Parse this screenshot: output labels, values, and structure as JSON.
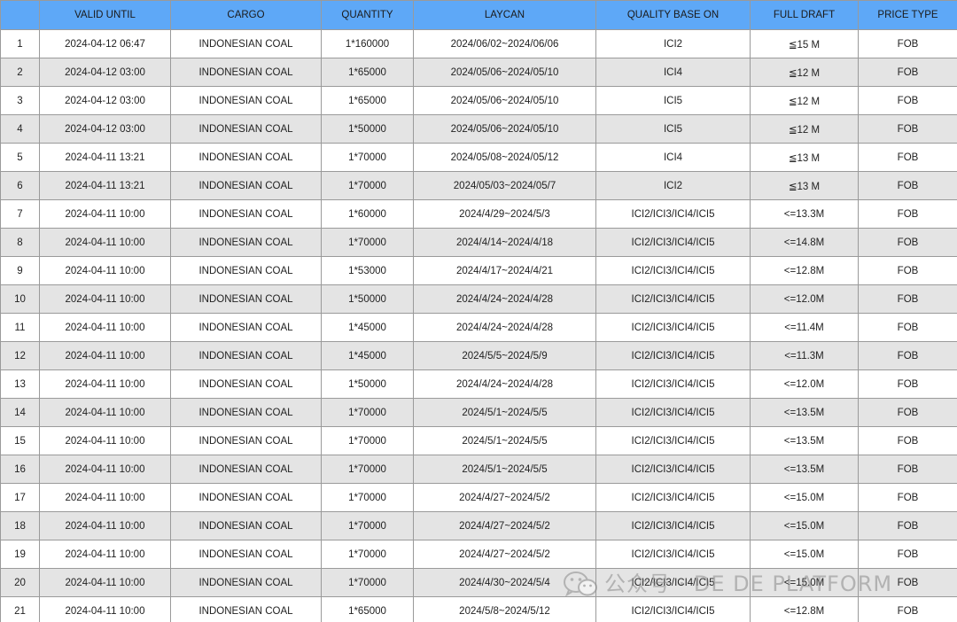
{
  "table": {
    "columns": [
      "",
      "VALID UNTIL",
      "CARGO",
      "QUANTITY",
      "LAYCAN",
      "QUALITY BASE ON",
      "FULL DRAFT",
      "PRICE TYPE"
    ],
    "rows": [
      [
        "1",
        "2024-04-12 06:47",
        "INDONESIAN COAL",
        "1*160000",
        "2024/06/02~2024/06/06",
        "ICI2",
        "≦15 M",
        "FOB"
      ],
      [
        "2",
        "2024-04-12 03:00",
        "INDONESIAN COAL",
        "1*65000",
        "2024/05/06~2024/05/10",
        "ICI4",
        "≦12 M",
        "FOB"
      ],
      [
        "3",
        "2024-04-12 03:00",
        "INDONESIAN COAL",
        "1*65000",
        "2024/05/06~2024/05/10",
        "ICI5",
        "≦12 M",
        "FOB"
      ],
      [
        "4",
        "2024-04-12 03:00",
        "INDONESIAN COAL",
        "1*50000",
        "2024/05/06~2024/05/10",
        "ICI5",
        "≦12 M",
        "FOB"
      ],
      [
        "5",
        "2024-04-11 13:21",
        "INDONESIAN COAL",
        "1*70000",
        "2024/05/08~2024/05/12",
        "ICI4",
        "≦13 M",
        "FOB"
      ],
      [
        "6",
        "2024-04-11 13:21",
        "INDONESIAN COAL",
        "1*70000",
        "2024/05/03~2024/05/7",
        "ICI2",
        "≦13 M",
        "FOB"
      ],
      [
        "7",
        "2024-04-11 10:00",
        "INDONESIAN COAL",
        "1*60000",
        "2024/4/29~2024/5/3",
        "ICI2/ICI3/ICI4/ICI5",
        "<=13.3M",
        "FOB"
      ],
      [
        "8",
        "2024-04-11 10:00",
        "INDONESIAN COAL",
        "1*70000",
        "2024/4/14~2024/4/18",
        "ICI2/ICI3/ICI4/ICI5",
        "<=14.8M",
        "FOB"
      ],
      [
        "9",
        "2024-04-11 10:00",
        "INDONESIAN COAL",
        "1*53000",
        "2024/4/17~2024/4/21",
        "ICI2/ICI3/ICI4/ICI5",
        "<=12.8M",
        "FOB"
      ],
      [
        "10",
        "2024-04-11 10:00",
        "INDONESIAN COAL",
        "1*50000",
        "2024/4/24~2024/4/28",
        "ICI2/ICI3/ICI4/ICI5",
        "<=12.0M",
        "FOB"
      ],
      [
        "11",
        "2024-04-11 10:00",
        "INDONESIAN COAL",
        "1*45000",
        "2024/4/24~2024/4/28",
        "ICI2/ICI3/ICI4/ICI5",
        "<=11.4M",
        "FOB"
      ],
      [
        "12",
        "2024-04-11 10:00",
        "INDONESIAN COAL",
        "1*45000",
        "2024/5/5~2024/5/9",
        "ICI2/ICI3/ICI4/ICI5",
        "<=11.3M",
        "FOB"
      ],
      [
        "13",
        "2024-04-11 10:00",
        "INDONESIAN COAL",
        "1*50000",
        "2024/4/24~2024/4/28",
        "ICI2/ICI3/ICI4/ICI5",
        "<=12.0M",
        "FOB"
      ],
      [
        "14",
        "2024-04-11 10:00",
        "INDONESIAN COAL",
        "1*70000",
        "2024/5/1~2024/5/5",
        "ICI2/ICI3/ICI4/ICI5",
        "<=13.5M",
        "FOB"
      ],
      [
        "15",
        "2024-04-11 10:00",
        "INDONESIAN COAL",
        "1*70000",
        "2024/5/1~2024/5/5",
        "ICI2/ICI3/ICI4/ICI5",
        "<=13.5M",
        "FOB"
      ],
      [
        "16",
        "2024-04-11 10:00",
        "INDONESIAN COAL",
        "1*70000",
        "2024/5/1~2024/5/5",
        "ICI2/ICI3/ICI4/ICI5",
        "<=13.5M",
        "FOB"
      ],
      [
        "17",
        "2024-04-11 10:00",
        "INDONESIAN COAL",
        "1*70000",
        "2024/4/27~2024/5/2",
        "ICI2/ICI3/ICI4/ICI5",
        "<=15.0M",
        "FOB"
      ],
      [
        "18",
        "2024-04-11 10:00",
        "INDONESIAN COAL",
        "1*70000",
        "2024/4/27~2024/5/2",
        "ICI2/ICI3/ICI4/ICI5",
        "<=15.0M",
        "FOB"
      ],
      [
        "19",
        "2024-04-11 10:00",
        "INDONESIAN COAL",
        "1*70000",
        "2024/4/27~2024/5/2",
        "ICI2/ICI3/ICI4/ICI5",
        "<=15.0M",
        "FOB"
      ],
      [
        "20",
        "2024-04-11 10:00",
        "INDONESIAN COAL",
        "1*70000",
        "2024/4/30~2024/5/4",
        "ICI2/ICI3/ICI4/ICI5",
        "<=15.0M",
        "FOB"
      ],
      [
        "21",
        "2024-04-11 10:00",
        "INDONESIAN COAL",
        "1*65000",
        "2024/5/8~2024/5/12",
        "ICI2/ICI3/ICI4/ICI5",
        "<=12.8M",
        "FOB"
      ]
    ]
  },
  "colors": {
    "header_bg": "#5ea8f7",
    "row_alt_bg": "#e4e4e4",
    "border": "#9a9a9a"
  },
  "watermark": {
    "icon": "wechat-icon",
    "text": "公众号 · DE DE PLATFORM"
  }
}
